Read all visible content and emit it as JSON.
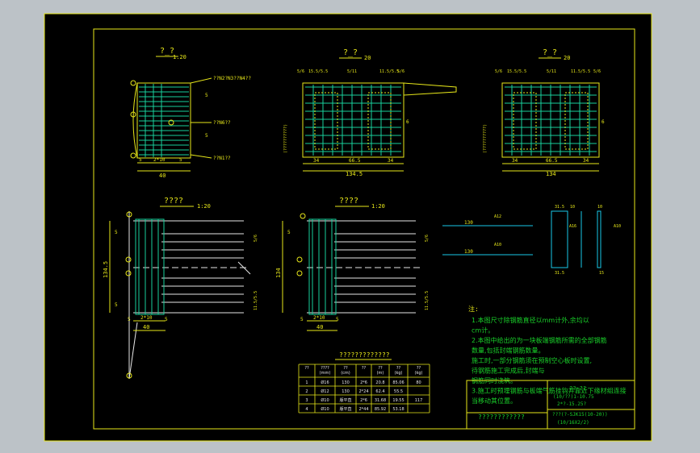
{
  "colors": {
    "background": "#bcc2c7",
    "sheet": "#000000",
    "frame": "#e8e81a",
    "rebar": "#19d19d",
    "grid_cyan": "#19c9e8",
    "text_yellow": "#e8e81a",
    "text_green": "#19d12a",
    "red": "#ff3b3b",
    "white": "#e6e6e6"
  },
  "views": {
    "section_1": {
      "title": "?_?",
      "scale": "1:20",
      "dim_a": "5",
      "dim_b": "5",
      "dim_c": "5",
      "dim_d": "5",
      "dim_e": "5",
      "dim_f": "5",
      "dim_g": "5",
      "dim_h": "5",
      "dim_i": "5",
      "dim_bottom_a": "5",
      "dim_bottom_b": "2*10",
      "dim_bottom_c": "5",
      "dim_bottom_total": "40",
      "label_n1": "??N2?N3??N4??",
      "label_n2": "??N6??",
      "label_n3": "??N1??"
    },
    "section_2": {
      "title": "?_?",
      "scale": "20",
      "top_label_a": "5/6",
      "top_label_b": "15.5/5.5",
      "top_label_c": "5/11",
      "top_label_d": "11.5/5.5",
      "top_label_e": "5/6",
      "left_dim_a": "5",
      "left_dim_b": "5",
      "left_dim_c": "5",
      "left_total": "(??????????)",
      "right_label": "6",
      "bottom_a": "5",
      "bottom_b": "66.5",
      "bottom_c": "5",
      "bottom_d": "34",
      "bottom_e": "34",
      "bottom_total": "134.5"
    },
    "section_3": {
      "title": "?_?",
      "scale": "20",
      "top_label_a": "5/6",
      "top_label_b": "15.5/5.5",
      "top_label_c": "5/11",
      "top_label_d": "11.5/5.5",
      "top_label_e": "5/6",
      "left_total": "(??????????)",
      "right_label": "6",
      "bottom_a": "5",
      "bottom_b": "66.5",
      "bottom_c": "5",
      "bottom_d": "34",
      "bottom_e": "34",
      "bottom_total": "134"
    },
    "elevation_1": {
      "title": "????",
      "scale": "1:20",
      "left_total": "134.5",
      "left_a": "5",
      "left_b": "5",
      "bottom_a": "5",
      "bottom_b": "2*10",
      "bottom_c": "5",
      "bottom_total": "40",
      "right_a": "5/6",
      "right_b": "11.5/5.5"
    },
    "elevation_2": {
      "title": "????",
      "scale": "1:20",
      "left_total": "134",
      "left_a": "5",
      "bottom_a": "5",
      "bottom_b": "2*10",
      "bottom_c": "5",
      "bottom_total": "40",
      "right_a": "5/6",
      "right_b": "11.5/5.5"
    },
    "detail_bars": {
      "line1_len": "130",
      "line1_tag": "A12",
      "line2_len": "130",
      "line2_tag": "A10",
      "stirrup_w": "31.5",
      "stirrup_h": "10",
      "stirrup_side": "10",
      "stirrup_inner": "15",
      "stirrup_b": "31.5",
      "stirrup_tag": "A16",
      "stirrup_tag2": "A10"
    }
  },
  "table": {
    "title": "?????????????",
    "headers": [
      "??",
      "????\n(mm)",
      "??\n(cm)",
      "??",
      "??\n(m)",
      "??\n(kg)",
      "??\n(kg)"
    ],
    "rows": [
      [
        "1",
        "Ø16",
        "130",
        "2*6",
        "20.8",
        "85.06",
        "80"
      ],
      [
        "2",
        "Ø12",
        "130",
        "2*24",
        "62.4",
        "55.5",
        ""
      ],
      [
        "3",
        "Ø10",
        "版平直",
        "2*6",
        "31.68",
        "19.55",
        "117"
      ],
      [
        "4",
        "Ø10",
        "版平直",
        "2*44",
        "85.92",
        "53.18",
        ""
      ]
    ]
  },
  "notes": {
    "heading": "注:",
    "lines": [
      "1.本图尺寸除钢筋直径以mm计外,余均以",
      "cm计。",
      "2.本图中给出的为一块板端钢筋所需的全部钢筋",
      "数量,包括封端钢筋数量。",
      "施工时,一部分钢筋须在预制空心板时设置,",
      "待钢筋施工完成后,封端与",
      "钢筋同时浇筑。",
      "3.施工时预埋钢筋与板端气筋挂钩并靠近下缘材组连接",
      "当移动其位置。"
    ]
  },
  "title_block": {
    "line_a": "??-??",
    "line_b": "(10/??)1-10.75",
    "line_c": "2*?-15.25?",
    "line_d": "???(?-SJK15(10-20))",
    "line_e": "(10/16X2/2)",
    "drawing_name": "????????????"
  }
}
